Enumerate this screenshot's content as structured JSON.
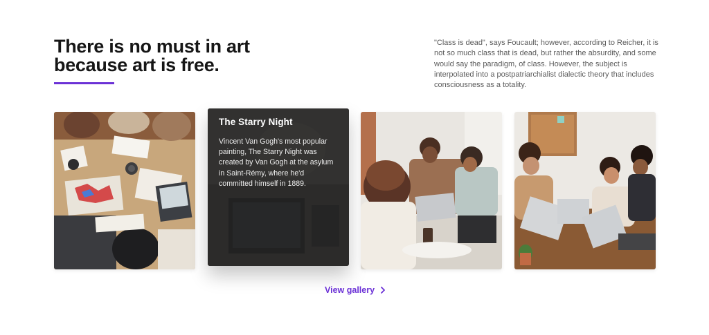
{
  "hero": {
    "headline_line1": "There is no must in art",
    "headline_line2": "because art is free.",
    "accent_color": "#6b31d6",
    "quote": "\"Class is dead\", says Foucault; however, according to Reicher, it is not so much class that is dead, but rather the absurdity, and some would say the paradigm, of class. However, the subject is interpolated into a postpatriarchialist dialectic theory that includes consciousness as a totality."
  },
  "cards": [
    {
      "image": "team-meeting-overhead-photo"
    },
    {
      "image": "laptop-desk-photo",
      "title": "The Starry Night",
      "description": "Vincent Van Gogh's most popular painting, The Starry Night was created by Van Gogh at the asylum in Saint-Rémy, where he'd committed himself in 1889."
    },
    {
      "image": "office-discussion-photo"
    },
    {
      "image": "team-laptops-photo"
    }
  ],
  "gallery": {
    "link_label": "View gallery",
    "icon": "chevron-right-icon",
    "color": "#6b31d6"
  }
}
